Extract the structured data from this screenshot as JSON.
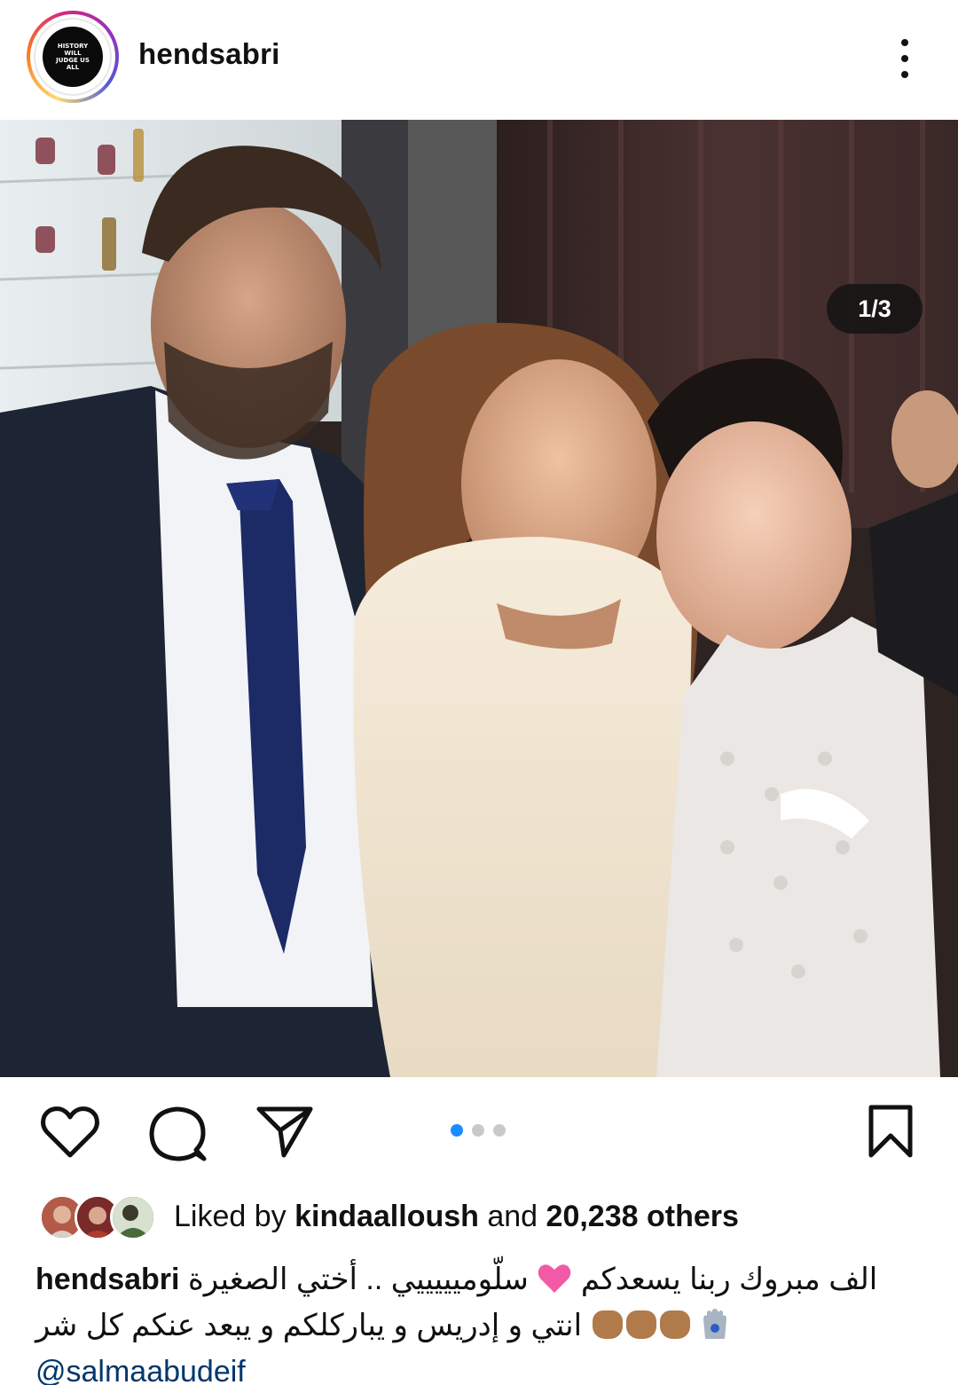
{
  "header": {
    "username": "hendsabri",
    "avatar_text": "HISTORY WILL JUDGE US ALL",
    "more_icon": "more-vertical-icon"
  },
  "post": {
    "image_counter": "1/3",
    "carousel_total": 3,
    "carousel_active": 1
  },
  "actions": {
    "like_icon": "heart-outline-icon",
    "comment_icon": "comment-bubble-icon",
    "share_icon": "paper-plane-icon",
    "save_icon": "bookmark-outline-icon"
  },
  "likes": {
    "prefix": "Liked by ",
    "user": "kindaalloush",
    "middle": " and ",
    "count": "20,238 others"
  },
  "caption": {
    "username": "hendsabri",
    "line1_text": "سلّوميييييي .. أختي الصغيرة",
    "line1_text_b": "الف مبروك ربنا يسعدكم",
    "line2_text": "انتي و إدريس و يباركلكم و يبعد عنكم كل شر",
    "mention": "@salmaabudeif"
  },
  "colors": {
    "accent_blue": "#1a8cff",
    "mention_blue": "#00376b",
    "dot_inactive": "#c9c9c9"
  }
}
